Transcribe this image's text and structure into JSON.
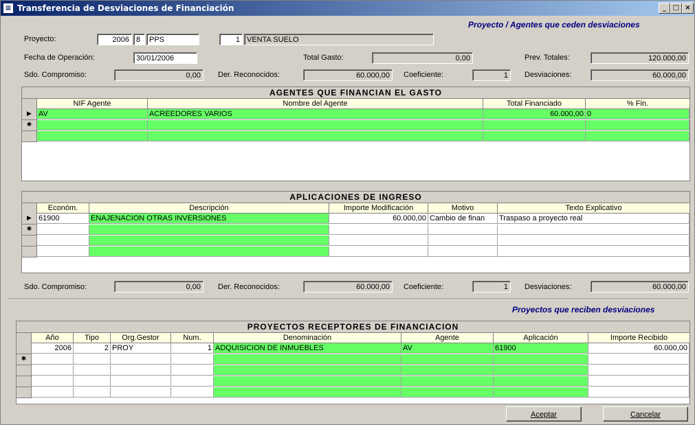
{
  "window": {
    "title": "Transferencia de Desviaciones de Financiación"
  },
  "header": {
    "section1": "Proyecto / Agentes que ceden desviaciones",
    "section2": "Proyectos que reciben desviaciones"
  },
  "form": {
    "proyecto_label": "Proyecto:",
    "proyecto_year": "2006",
    "proyecto_type": "8",
    "proyecto_code": "PPS",
    "proyecto_num": "1",
    "proyecto_name": "VENTA SUELO",
    "fecha_label": "Fecha de Operación:",
    "fecha_value": "30/01/2006",
    "total_gasto_label": "Total Gasto:",
    "total_gasto_value": "0,00",
    "prev_totales_label": "Prev. Totales:",
    "prev_totales_value": "120.000,00",
    "sdo_label": "Sdo. Compromiso:",
    "sdo_value": "0,00",
    "der_label": "Der. Reconocidos:",
    "der_value": "60.000,00",
    "coef_label": "Coeficiente:",
    "coef_value": "1",
    "desv_label": "Desviaciones:",
    "desv_value": "60.000,00"
  },
  "agentes": {
    "title": "AGENTES QUE FINANCIAN EL GASTO",
    "columns": [
      "NIF Agente",
      "Nombre del Agente",
      "Total Financiado",
      "% Fin."
    ],
    "rows": [
      [
        "AV",
        "ACREEDORES VARIOS",
        "60.000,00",
        "0"
      ]
    ]
  },
  "aplicaciones": {
    "title": "APLICACIONES DE INGRESO",
    "columns": [
      "Económ.",
      "Descripción",
      "Importe Modificación",
      "Motivo",
      "Texto Explicativo"
    ],
    "rows": [
      [
        "61900",
        "ENAJENACION OTRAS INVERSIONES",
        "60.000,00",
        "Cambio de finan",
        "Traspaso a proyecto real"
      ]
    ]
  },
  "totals2": {
    "sdo_label": "Sdo. Compromiso:",
    "sdo_value": "0,00",
    "der_label": "Der. Reconocidos:",
    "der_value": "60.000,00",
    "coef_label": "Coeficiente:",
    "coef_value": "1",
    "desv_label": "Desviaciones:",
    "desv_value": "60.000,00"
  },
  "receptores": {
    "title": "PROYECTOS RECEPTORES DE FINANCIACION",
    "columns": [
      "Año",
      "Tipo",
      "Org.Gestor",
      "Num.",
      "Denominación",
      "Agente",
      "Aplicación",
      "Importe Recibido"
    ],
    "rows": [
      [
        "2006",
        "2",
        "PROY",
        "1",
        "ADQUISICION DE INMUEBLES",
        "AV",
        "61900",
        "60.000,00"
      ]
    ]
  },
  "buttons": {
    "aceptar": "Aceptar",
    "cancelar": "Cancelar"
  },
  "row_markers": {
    "current": "▶",
    "new": "✱"
  },
  "controls": {
    "minimize": "_",
    "maximize": "□",
    "close": "×"
  }
}
